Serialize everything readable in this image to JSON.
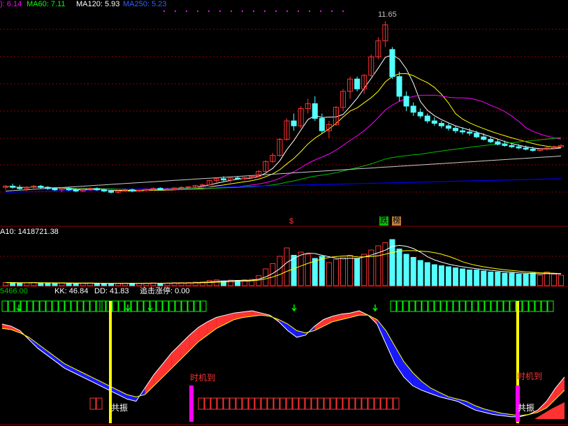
{
  "colors": {
    "up": "#ff3232",
    "down": "#54ffff",
    "ma5": "#ffffff",
    "ma10": "#ffff00",
    "ma20": "#ff00ff",
    "ma60": "#00c000",
    "ma120": "#cccccc",
    "ma250": "#0000ff",
    "grid": "#8b0000",
    "green": "#00ff00",
    "yellow": "#ffff00",
    "magenta": "#ff00ff"
  },
  "price_panel": {
    "ma_labels": [
      "): 6.14",
      "MA60: 7.11",
      "MA120: 5.93",
      "MA250: 5.23"
    ],
    "peak_label": "11.65",
    "marker_s": "$",
    "tag_die": "跌",
    "tag_bang": "榜"
  },
  "volume_panel": {
    "label": "A10: 1418721.38"
  },
  "indicator_panel": {
    "label_left": "5466.00",
    "kk_label": "KK: 46.84",
    "dd_label": "DD: 41.83",
    "zt_label": "追击涨停: 0.00",
    "timing_text": "时机到",
    "resonance_text": "共振"
  },
  "chart_data": [
    {
      "type": "candlestick",
      "title": "",
      "series": [
        {
          "name": "MA60",
          "value": 7.11
        },
        {
          "name": "MA120",
          "value": 5.93
        },
        {
          "name": "MA250",
          "value": 5.23
        }
      ],
      "ohlc": [
        [
          4.9,
          5.0,
          4.8,
          4.95
        ],
        [
          4.95,
          5.05,
          4.85,
          4.9
        ],
        [
          4.9,
          5.0,
          4.8,
          4.85
        ],
        [
          4.85,
          4.95,
          4.75,
          4.9
        ],
        [
          4.9,
          5.0,
          4.8,
          4.95
        ],
        [
          4.95,
          5.0,
          4.85,
          4.9
        ],
        [
          4.9,
          4.95,
          4.8,
          4.85
        ],
        [
          4.85,
          4.9,
          4.75,
          4.8
        ],
        [
          4.8,
          4.9,
          4.7,
          4.85
        ],
        [
          4.85,
          4.9,
          4.75,
          4.8
        ],
        [
          4.8,
          4.85,
          4.7,
          4.75
        ],
        [
          4.75,
          4.85,
          4.7,
          4.8
        ],
        [
          4.8,
          4.9,
          4.75,
          4.85
        ],
        [
          4.85,
          4.9,
          4.75,
          4.8
        ],
        [
          4.8,
          4.85,
          4.7,
          4.75
        ],
        [
          4.75,
          4.8,
          4.65,
          4.7
        ],
        [
          4.7,
          4.8,
          4.65,
          4.75
        ],
        [
          4.75,
          4.85,
          4.7,
          4.8
        ],
        [
          4.8,
          4.85,
          4.7,
          4.75
        ],
        [
          4.75,
          4.8,
          4.7,
          4.78
        ],
        [
          4.78,
          4.85,
          4.72,
          4.82
        ],
        [
          4.82,
          4.9,
          4.78,
          4.86
        ],
        [
          4.86,
          4.9,
          4.78,
          4.8
        ],
        [
          4.8,
          4.88,
          4.76,
          4.84
        ],
        [
          4.84,
          4.9,
          4.8,
          4.88
        ],
        [
          4.88,
          4.95,
          4.82,
          4.9
        ],
        [
          4.9,
          4.95,
          4.85,
          4.92
        ],
        [
          4.92,
          5.0,
          4.88,
          4.98
        ],
        [
          4.98,
          5.05,
          4.92,
          5.0
        ],
        [
          5.0,
          5.2,
          4.98,
          5.18
        ],
        [
          5.18,
          5.3,
          5.1,
          5.25
        ],
        [
          5.25,
          5.35,
          5.15,
          5.2
        ],
        [
          5.2,
          5.3,
          5.1,
          5.28
        ],
        [
          5.28,
          5.35,
          5.2,
          5.25
        ],
        [
          5.25,
          5.32,
          5.18,
          5.3
        ],
        [
          5.3,
          5.4,
          5.25,
          5.35
        ],
        [
          5.35,
          5.6,
          5.3,
          5.55
        ],
        [
          5.55,
          6.0,
          5.5,
          5.95
        ],
        [
          5.95,
          6.3,
          5.9,
          6.2
        ],
        [
          6.2,
          6.9,
          6.15,
          6.85
        ],
        [
          6.85,
          7.7,
          6.8,
          7.6
        ],
        [
          7.6,
          7.9,
          7.2,
          7.4
        ],
        [
          7.4,
          8.2,
          7.3,
          8.1
        ],
        [
          8.1,
          8.5,
          7.9,
          8.3
        ],
        [
          8.3,
          8.6,
          7.6,
          7.7
        ],
        [
          7.7,
          7.9,
          7.1,
          7.2
        ],
        [
          7.2,
          7.6,
          6.9,
          7.45
        ],
        [
          7.45,
          8.2,
          7.4,
          8.15
        ],
        [
          8.15,
          8.9,
          8.0,
          8.8
        ],
        [
          8.8,
          9.4,
          8.5,
          9.3
        ],
        [
          9.3,
          9.4,
          8.8,
          8.9
        ],
        [
          8.9,
          9.5,
          8.7,
          9.45
        ],
        [
          9.45,
          10.3,
          9.4,
          10.2
        ],
        [
          10.2,
          11.0,
          10.1,
          10.85
        ],
        [
          10.85,
          11.65,
          10.6,
          11.5
        ],
        [
          10.5,
          10.6,
          9.3,
          9.4
        ],
        [
          9.4,
          9.6,
          8.4,
          8.6
        ],
        [
          8.6,
          8.8,
          8.0,
          8.2
        ],
        [
          8.2,
          8.35,
          7.8,
          7.95
        ],
        [
          7.95,
          8.1,
          7.7,
          7.8
        ],
        [
          7.8,
          7.9,
          7.5,
          7.6
        ],
        [
          7.6,
          7.75,
          7.4,
          7.5
        ],
        [
          7.5,
          7.6,
          7.3,
          7.4
        ],
        [
          7.4,
          7.5,
          7.2,
          7.3
        ],
        [
          7.3,
          7.4,
          7.1,
          7.2
        ],
        [
          7.2,
          7.35,
          7.05,
          7.15
        ],
        [
          7.15,
          7.3,
          7.0,
          7.1
        ],
        [
          7.1,
          7.2,
          6.9,
          6.95
        ],
        [
          6.95,
          7.1,
          6.8,
          6.85
        ],
        [
          6.85,
          6.95,
          6.7,
          6.75
        ],
        [
          6.75,
          6.85,
          6.6,
          6.65
        ],
        [
          6.65,
          6.8,
          6.55,
          6.6
        ],
        [
          6.6,
          6.7,
          6.5,
          6.55
        ],
        [
          6.55,
          6.65,
          6.45,
          6.5
        ],
        [
          6.5,
          6.6,
          6.4,
          6.45
        ],
        [
          6.45,
          6.55,
          6.35,
          6.4
        ],
        [
          6.4,
          6.5,
          6.35,
          6.45
        ],
        [
          6.45,
          6.55,
          6.4,
          6.5
        ],
        [
          6.5,
          6.6,
          6.45,
          6.55
        ],
        [
          6.55,
          6.65,
          6.5,
          6.6
        ]
      ]
    },
    {
      "type": "bar",
      "title": "",
      "values": [
        0.3,
        0.28,
        0.25,
        0.27,
        0.3,
        0.26,
        0.24,
        0.22,
        0.25,
        0.23,
        0.21,
        0.22,
        0.24,
        0.23,
        0.2,
        0.19,
        0.22,
        0.24,
        0.23,
        0.21,
        0.24,
        0.26,
        0.22,
        0.25,
        0.27,
        0.28,
        0.29,
        0.33,
        0.35,
        0.5,
        0.55,
        0.45,
        0.52,
        0.48,
        0.55,
        0.6,
        0.95,
        1.6,
        2.1,
        2.8,
        3.6,
        2.9,
        3.2,
        3.0,
        2.6,
        2.8,
        2.2,
        2.5,
        2.7,
        2.9,
        2.6,
        3.0,
        3.4,
        3.8,
        4.1,
        4.4,
        3.5,
        3.0,
        2.7,
        2.4,
        2.2,
        2.0,
        1.9,
        1.8,
        1.7,
        1.6,
        1.5,
        1.5,
        1.4,
        1.3,
        1.3,
        1.2,
        1.2,
        1.1,
        1.1,
        1.2,
        1.0,
        1.3,
        1.1,
        1.0
      ]
    },
    {
      "type": "line",
      "title": "",
      "series": [
        {
          "name": "KK",
          "values": [
            88,
            86,
            82,
            74,
            66,
            60,
            54,
            48,
            44,
            40,
            36,
            32,
            28,
            24,
            20,
            18,
            30,
            42,
            52,
            62,
            70,
            78,
            85,
            90,
            94,
            96,
            98,
            99,
            100,
            98,
            96,
            90,
            82,
            76,
            78,
            86,
            92,
            95,
            97,
            98,
            100,
            96,
            88,
            70,
            52,
            40,
            32,
            28,
            25,
            22,
            20,
            18,
            14,
            10,
            8,
            6,
            5,
            4,
            4,
            6,
            10,
            18,
            30,
            40
          ]
        },
        {
          "name": "DD",
          "values": [
            84,
            83,
            80,
            76,
            70,
            64,
            58,
            52,
            48,
            44,
            40,
            36,
            32,
            28,
            24,
            22,
            24,
            32,
            40,
            48,
            56,
            64,
            72,
            78,
            84,
            88,
            92,
            94,
            95,
            96,
            95,
            92,
            88,
            82,
            80,
            82,
            86,
            90,
            92,
            94,
            96,
            96,
            92,
            82,
            68,
            54,
            44,
            36,
            30,
            26,
            22,
            20,
            18,
            14,
            11,
            9,
            7,
            6,
            5,
            6,
            8,
            12,
            20,
            28
          ]
        }
      ]
    }
  ]
}
